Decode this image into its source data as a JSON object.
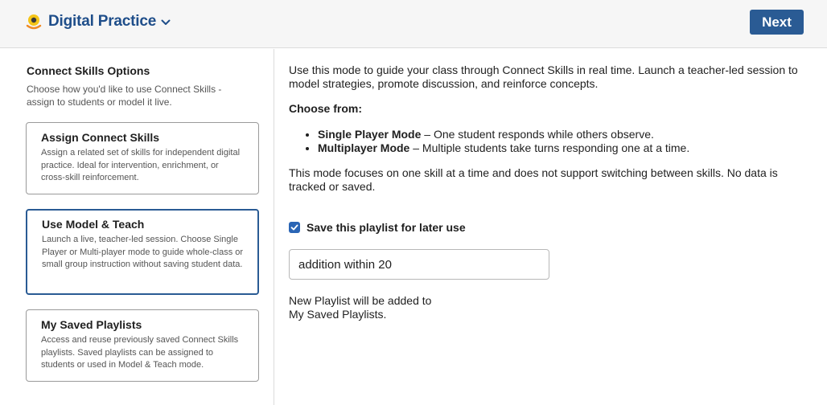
{
  "header": {
    "app_title": "Digital Practice",
    "logo_icon": "digital-practice-logo-icon",
    "next_label": "Next",
    "accent_color": "#2a5b94"
  },
  "sidebar": {
    "title": "Connect Skills Options",
    "description": "Choose how you'd like to use Connect Skills - assign to students or model it live.",
    "options": [
      {
        "title": "Assign Connect Skills",
        "description": "Assign a related set of skills for independent digital practice. Ideal for intervention, enrichment, or cross-skill reinforcement.",
        "selected": false
      },
      {
        "title": "Use Model & Teach",
        "description": "Launch a live, teacher-led session. Choose Single Player or Multi-player mode to guide whole-class or small group instruction without saving student data.",
        "selected": true
      },
      {
        "title": "My Saved Playlists",
        "description": "Access and reuse previously saved Connect Skills playlists. Saved playlists can be assigned to students or used in Model & Teach mode.",
        "selected": false
      }
    ]
  },
  "main": {
    "intro": "Use this mode to guide your class through Connect Skills in real time. Launch a teacher-led session to model strategies, promote discussion, and reinforce concepts.",
    "choose_label": "Choose from:",
    "modes": [
      {
        "name": "Single Player Mode",
        "desc": " – One student responds while others observe."
      },
      {
        "name": "Multiplayer Mode",
        "desc": " – Multiple students take turns responding one at a time."
      }
    ],
    "note": "This mode focuses on one skill at a time and does not support switching between skills. No data is tracked or saved.",
    "save_checkbox_label": "Save this playlist for later use",
    "save_checked": true,
    "playlist_name_value": "addition within 20",
    "added_note_line1": "New Playlist will be added to",
    "added_note_line2": "My Saved Playlists."
  }
}
